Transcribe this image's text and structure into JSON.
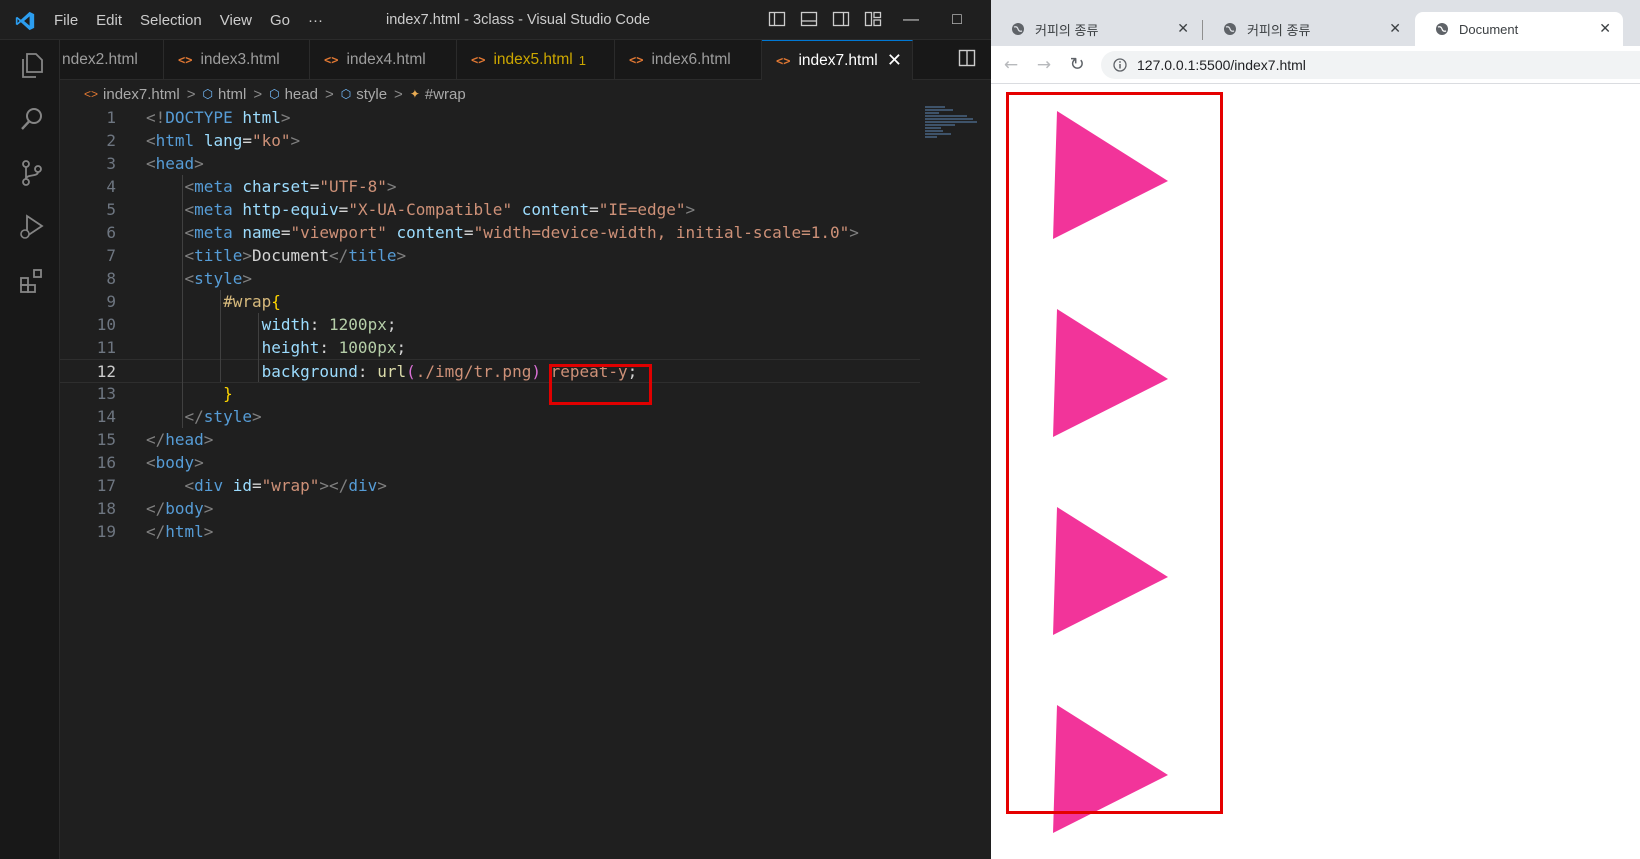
{
  "vscode": {
    "menu": [
      "File",
      "Edit",
      "Selection",
      "View",
      "Go",
      "···"
    ],
    "window_title": "index7.html - 3class - Visual Studio Code",
    "window_controls": {
      "minimize": "—",
      "maximize": "□"
    },
    "tabs": [
      {
        "label": "ndex2.html",
        "has_icon": false,
        "modified": false,
        "active": false
      },
      {
        "label": "index3.html",
        "has_icon": true,
        "modified": false,
        "active": false
      },
      {
        "label": "index4.html",
        "has_icon": true,
        "modified": false,
        "active": false
      },
      {
        "label": "index5.html",
        "badge": "1",
        "has_icon": true,
        "modified": true,
        "active": false
      },
      {
        "label": "index6.html",
        "has_icon": true,
        "modified": false,
        "active": false
      },
      {
        "label": "index7.html",
        "has_icon": true,
        "modified": false,
        "active": true,
        "close": "✕"
      }
    ],
    "file_icon": "<>",
    "breadcrumb": [
      {
        "label": "index7.html",
        "icon": "html-file-icon"
      },
      {
        "label": "html",
        "icon": "element-cube-icon"
      },
      {
        "label": "head",
        "icon": "element-cube-icon"
      },
      {
        "label": "style",
        "icon": "element-cube-icon"
      },
      {
        "label": "#wrap",
        "icon": "css-selector-icon"
      }
    ],
    "breadcrumb_sep": ">",
    "current_line": 12,
    "lines": [
      {
        "n": "1",
        "tokens": [
          [
            "punc",
            "<!"
          ],
          [
            "tag",
            "DOCTYPE"
          ],
          [
            "text",
            " "
          ],
          [
            "attr",
            "html"
          ],
          [
            "punc",
            ">"
          ]
        ]
      },
      {
        "n": "2",
        "tokens": [
          [
            "punc",
            "<"
          ],
          [
            "tag",
            "html"
          ],
          [
            "text",
            " "
          ],
          [
            "attr",
            "lang"
          ],
          [
            "text",
            "="
          ],
          [
            "str",
            "\"ko\""
          ],
          [
            "punc",
            ">"
          ]
        ]
      },
      {
        "n": "3",
        "tokens": [
          [
            "punc",
            "<"
          ],
          [
            "tag",
            "head"
          ],
          [
            "punc",
            ">"
          ]
        ]
      },
      {
        "n": "4",
        "tokens": [
          [
            "text",
            "    "
          ],
          [
            "punc",
            "<"
          ],
          [
            "tag",
            "meta"
          ],
          [
            "text",
            " "
          ],
          [
            "attr",
            "charset"
          ],
          [
            "text",
            "="
          ],
          [
            "str",
            "\"UTF-8\""
          ],
          [
            "punc",
            ">"
          ]
        ]
      },
      {
        "n": "5",
        "tokens": [
          [
            "text",
            "    "
          ],
          [
            "punc",
            "<"
          ],
          [
            "tag",
            "meta"
          ],
          [
            "text",
            " "
          ],
          [
            "attr",
            "http-equiv"
          ],
          [
            "text",
            "="
          ],
          [
            "str",
            "\"X-UA-Compatible\""
          ],
          [
            "text",
            " "
          ],
          [
            "attr",
            "content"
          ],
          [
            "text",
            "="
          ],
          [
            "str",
            "\"IE=edge\""
          ],
          [
            "punc",
            ">"
          ]
        ]
      },
      {
        "n": "6",
        "tokens": [
          [
            "text",
            "    "
          ],
          [
            "punc",
            "<"
          ],
          [
            "tag",
            "meta"
          ],
          [
            "text",
            " "
          ],
          [
            "attr",
            "name"
          ],
          [
            "text",
            "="
          ],
          [
            "str",
            "\"viewport\""
          ],
          [
            "text",
            " "
          ],
          [
            "attr",
            "content"
          ],
          [
            "text",
            "="
          ],
          [
            "str",
            "\"width=device-width, initial-scale=1.0\""
          ],
          [
            "punc",
            ">"
          ]
        ]
      },
      {
        "n": "7",
        "tokens": [
          [
            "text",
            "    "
          ],
          [
            "punc",
            "<"
          ],
          [
            "tag",
            "title"
          ],
          [
            "punc",
            ">"
          ],
          [
            "text",
            "Document"
          ],
          [
            "punc",
            "</"
          ],
          [
            "tag",
            "title"
          ],
          [
            "punc",
            ">"
          ]
        ]
      },
      {
        "n": "8",
        "tokens": [
          [
            "text",
            "    "
          ],
          [
            "punc",
            "<"
          ],
          [
            "tag",
            "style"
          ],
          [
            "punc",
            ">"
          ]
        ]
      },
      {
        "n": "9",
        "tokens": [
          [
            "text",
            "        "
          ],
          [
            "sel",
            "#wrap"
          ],
          [
            "brace",
            "{"
          ]
        ]
      },
      {
        "n": "10",
        "tokens": [
          [
            "text",
            "            "
          ],
          [
            "prop",
            "width"
          ],
          [
            "text",
            ": "
          ],
          [
            "num",
            "1200px"
          ],
          [
            "text",
            ";"
          ]
        ]
      },
      {
        "n": "11",
        "tokens": [
          [
            "text",
            "            "
          ],
          [
            "prop",
            "height"
          ],
          [
            "text",
            ": "
          ],
          [
            "num",
            "1000px"
          ],
          [
            "text",
            ";"
          ]
        ]
      },
      {
        "n": "12",
        "tokens": [
          [
            "text",
            "            "
          ],
          [
            "prop",
            "background"
          ],
          [
            "text",
            ": "
          ],
          [
            "fn",
            "url"
          ],
          [
            "brace2",
            "("
          ],
          [
            "str",
            "./img/tr.png"
          ],
          [
            "brace2",
            ")"
          ],
          [
            "text",
            " "
          ],
          [
            "kw",
            "repeat-y"
          ],
          [
            "text",
            ";"
          ]
        ]
      },
      {
        "n": "13",
        "tokens": [
          [
            "text",
            "        "
          ],
          [
            "brace",
            "}"
          ]
        ]
      },
      {
        "n": "14",
        "tokens": [
          [
            "text",
            "    "
          ],
          [
            "punc",
            "</"
          ],
          [
            "tag",
            "style"
          ],
          [
            "punc",
            ">"
          ]
        ]
      },
      {
        "n": "15",
        "tokens": [
          [
            "punc",
            "</"
          ],
          [
            "tag",
            "head"
          ],
          [
            "punc",
            ">"
          ]
        ]
      },
      {
        "n": "16",
        "tokens": [
          [
            "punc",
            "<"
          ],
          [
            "tag",
            "body"
          ],
          [
            "punc",
            ">"
          ]
        ]
      },
      {
        "n": "17",
        "tokens": [
          [
            "text",
            "    "
          ],
          [
            "punc",
            "<"
          ],
          [
            "tag",
            "div"
          ],
          [
            "text",
            " "
          ],
          [
            "attr",
            "id"
          ],
          [
            "text",
            "="
          ],
          [
            "str",
            "\"wrap\""
          ],
          [
            "punc",
            "></"
          ],
          [
            "tag",
            "div"
          ],
          [
            "punc",
            ">"
          ]
        ]
      },
      {
        "n": "18",
        "tokens": [
          [
            "punc",
            "</"
          ],
          [
            "tag",
            "body"
          ],
          [
            "punc",
            ">"
          ]
        ]
      },
      {
        "n": "19",
        "tokens": [
          [
            "punc",
            "</"
          ],
          [
            "tag",
            "html"
          ],
          [
            "punc",
            ">"
          ]
        ]
      }
    ]
  },
  "browser": {
    "tabs": [
      {
        "title": "커피의 종류",
        "active": false
      },
      {
        "title": "커피의 종류",
        "active": false
      },
      {
        "title": "Document",
        "active": true
      }
    ],
    "tab_close": "✕",
    "nav": {
      "back": "←",
      "forward": "→",
      "reload": "↻"
    },
    "address": "127.0.0.1:5500/index7.html",
    "page": {
      "triangle_count": 4,
      "triangle_color": "#f2349a",
      "outline_color": "#e50000"
    }
  },
  "colors": {
    "vscode_accent": "#0078d4",
    "highlight_box": "#e00000"
  }
}
